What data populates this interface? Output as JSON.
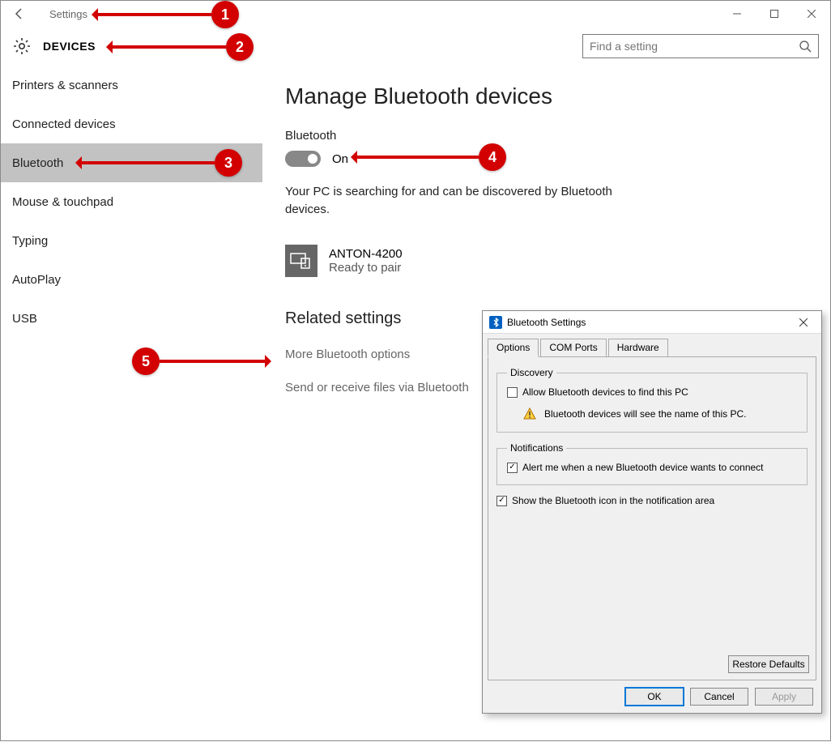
{
  "titlebar": {
    "title": "Settings"
  },
  "header": {
    "section": "DEVICES",
    "search_placeholder": "Find a setting"
  },
  "sidebar": {
    "items": [
      {
        "label": "Printers & scanners"
      },
      {
        "label": "Connected devices"
      },
      {
        "label": "Bluetooth",
        "active": true
      },
      {
        "label": "Mouse & touchpad"
      },
      {
        "label": "Typing"
      },
      {
        "label": "AutoPlay"
      },
      {
        "label": "USB"
      }
    ]
  },
  "main": {
    "heading": "Manage Bluetooth devices",
    "toggle_label": "Bluetooth",
    "toggle_state": "On",
    "status_text": "Your PC is searching for and can be discovered by Bluetooth devices.",
    "device": {
      "name": "ANTON-4200",
      "status": "Ready to pair"
    },
    "related_heading": "Related settings",
    "links": [
      "More Bluetooth options",
      "Send or receive files via Bluetooth"
    ]
  },
  "dialog": {
    "title": "Bluetooth Settings",
    "tabs": [
      "Options",
      "COM Ports",
      "Hardware"
    ],
    "discovery": {
      "legend": "Discovery",
      "checkbox": "Allow Bluetooth devices to find this PC",
      "warning": "Bluetooth devices will see the name of this PC."
    },
    "notifications": {
      "legend": "Notifications",
      "checkbox": "Alert me when a new Bluetooth device wants to connect"
    },
    "show_icon": "Show the Bluetooth icon in the notification area",
    "buttons": {
      "restore": "Restore Defaults",
      "ok": "OK",
      "cancel": "Cancel",
      "apply": "Apply"
    }
  },
  "callouts": {
    "1": "1",
    "2": "2",
    "3": "3",
    "4": "4",
    "5": "5"
  }
}
